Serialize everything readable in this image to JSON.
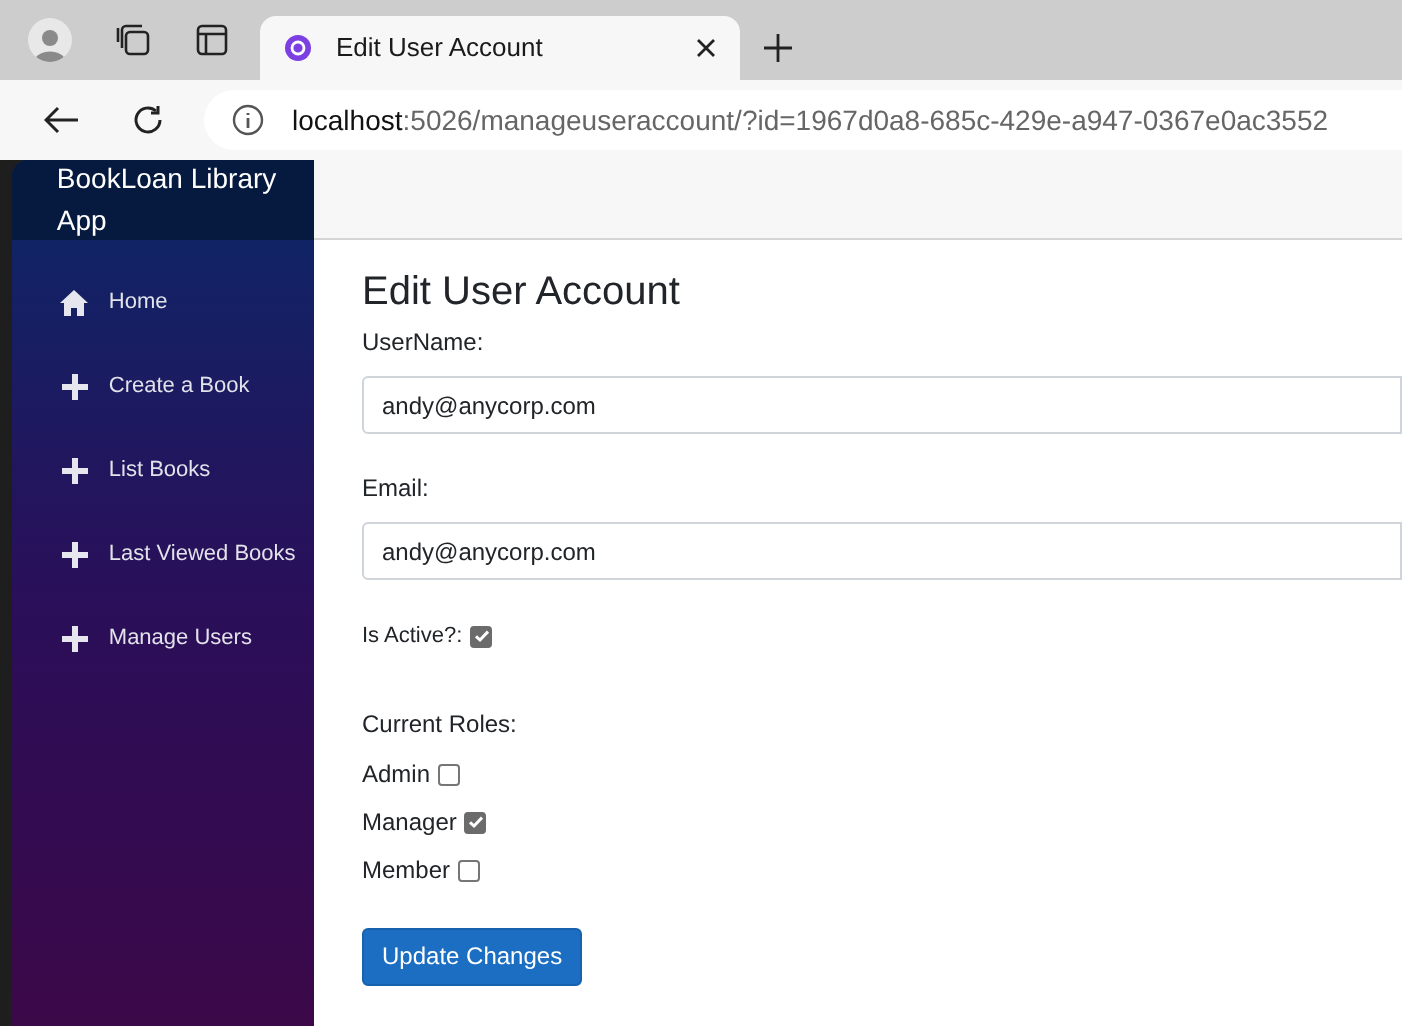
{
  "browser": {
    "tab_title": "Edit User Account",
    "url_host": "localhost",
    "url_path": ":5026/manageuseraccount/?id=1967d0a8-685c-429e-a947-0367e0ac3552"
  },
  "sidebar": {
    "brand": "BookLoan Library App",
    "items": [
      {
        "label": "Home",
        "kind": "home"
      },
      {
        "label": "Create a Book",
        "kind": "plus"
      },
      {
        "label": "List Books",
        "kind": "plus"
      },
      {
        "label": "Last Viewed Books",
        "kind": "plus"
      },
      {
        "label": "Manage Users",
        "kind": "plus"
      }
    ]
  },
  "form": {
    "title": "Edit User Account",
    "fields": [
      {
        "label": "UserName:",
        "value": "andy@anycorp.com"
      },
      {
        "label": "Email:",
        "value": "andy@anycorp.com"
      }
    ],
    "is_active": {
      "label": "Is Active?:",
      "checked": true
    },
    "roles_label": "Current Roles:",
    "roles": [
      {
        "label": "Admin",
        "checked": false
      },
      {
        "label": "Manager",
        "checked": true
      },
      {
        "label": "Member",
        "checked": false
      }
    ],
    "submit": "Update Changes"
  }
}
